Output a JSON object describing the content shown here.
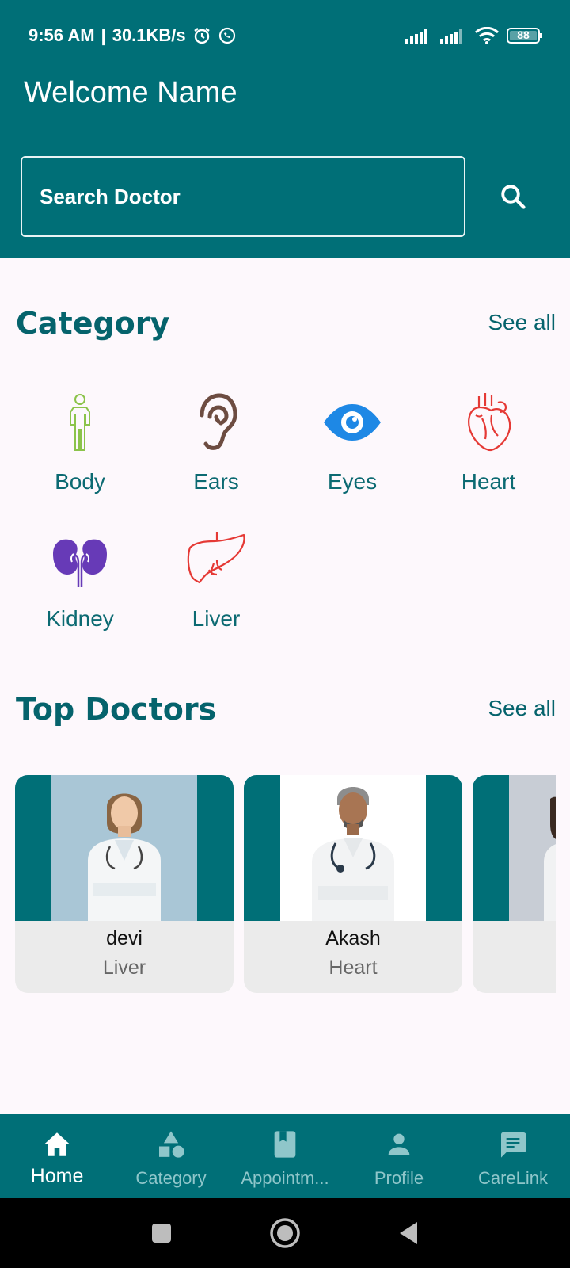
{
  "status_bar": {
    "time": "9:56 AM",
    "speed": "30.1KB/s",
    "battery": "88"
  },
  "header": {
    "welcome": "Welcome Name"
  },
  "search": {
    "placeholder": "Search Doctor",
    "value": ""
  },
  "category_section": {
    "title": "Category",
    "see_all": "See all",
    "items": [
      {
        "label": "Body",
        "icon": "body-icon",
        "color": "#8bc34a"
      },
      {
        "label": "Ears",
        "icon": "ear-icon",
        "color": "#795548"
      },
      {
        "label": "Eyes",
        "icon": "eye-icon",
        "color": "#1e88e5"
      },
      {
        "label": "Heart",
        "icon": "heart-organ-icon",
        "color": "#e53935"
      },
      {
        "label": "Kidney",
        "icon": "kidney-icon",
        "color": "#673ab7"
      },
      {
        "label": "Liver",
        "icon": "liver-icon",
        "color": "#e53935"
      }
    ]
  },
  "doctors_section": {
    "title": "Top Doctors",
    "see_all": "See all",
    "doctors": [
      {
        "name": "devi",
        "specialty": "Liver"
      },
      {
        "name": "Akash",
        "specialty": "Heart"
      },
      {
        "name": "",
        "specialty": ""
      }
    ]
  },
  "bottom_nav": {
    "items": [
      {
        "label": "Home",
        "icon": "home-icon",
        "active": true
      },
      {
        "label": "Category",
        "icon": "category-icon",
        "active": false
      },
      {
        "label": "Appointm...",
        "icon": "book-icon",
        "active": false
      },
      {
        "label": "Profile",
        "icon": "person-icon",
        "active": false
      },
      {
        "label": "CareLink",
        "icon": "chat-icon",
        "active": false
      }
    ]
  },
  "colors": {
    "primary": "#006f77",
    "background": "#fdf8fc",
    "card": "#ebebeb"
  }
}
